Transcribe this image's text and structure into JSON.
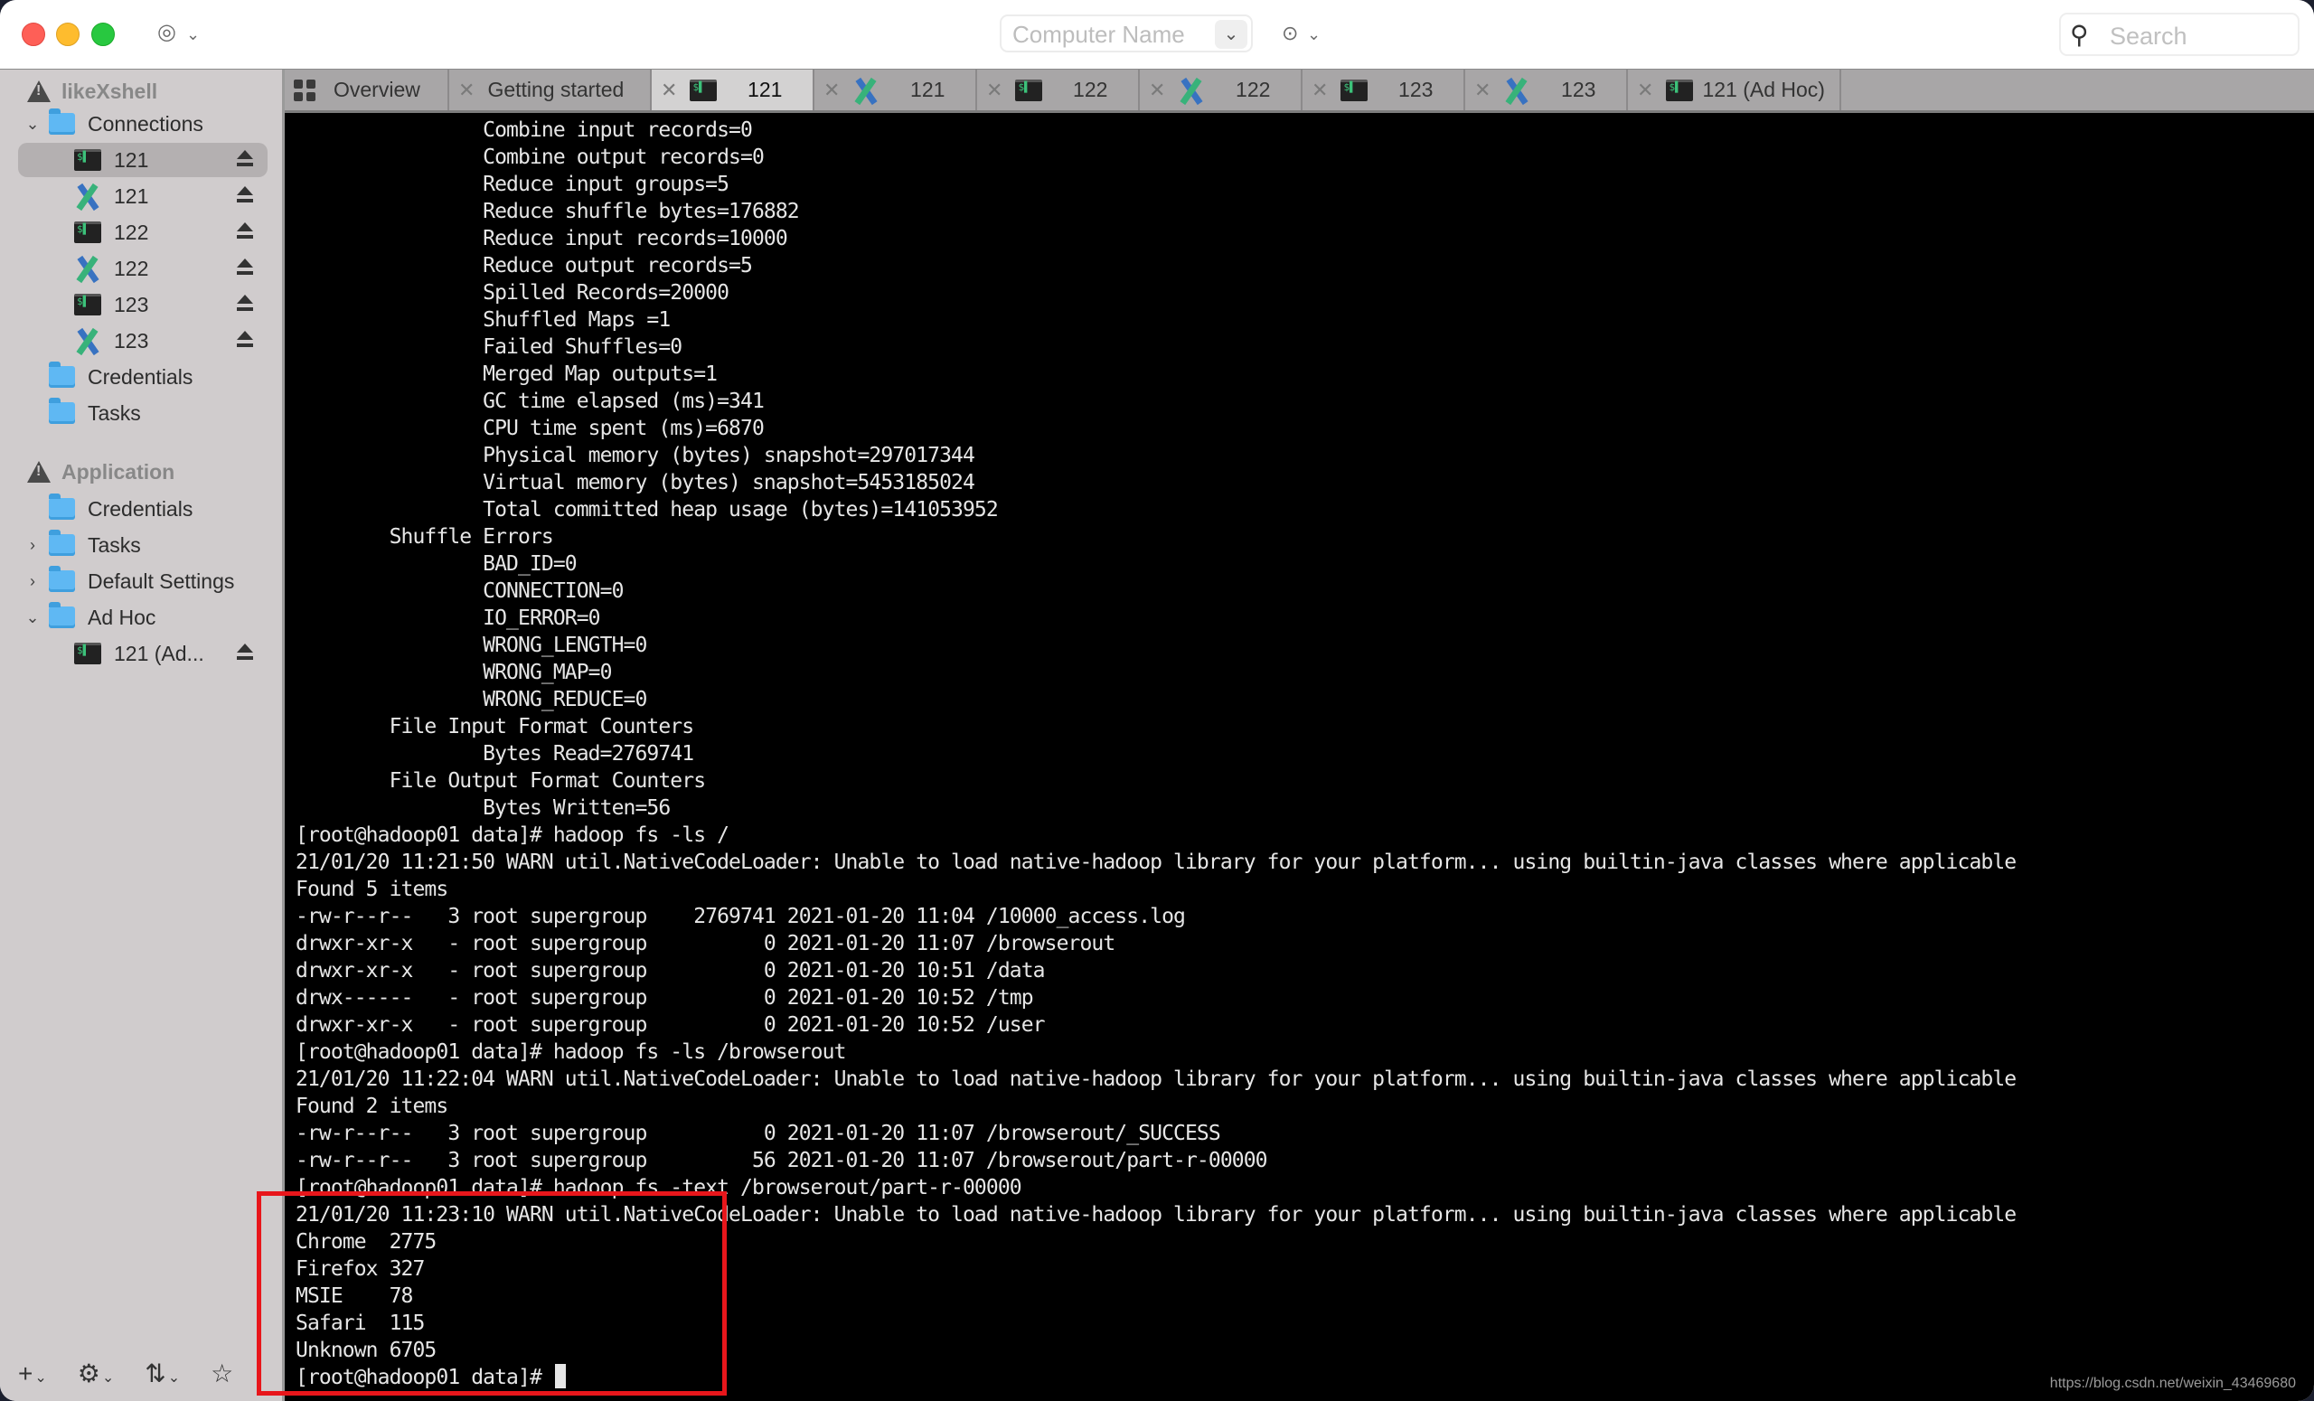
{
  "titlebar": {
    "computer_name_placeholder": "Computer Name",
    "search_placeholder": "Search"
  },
  "sidebar": {
    "app_section": "likeXshell",
    "connections_folder": "Connections",
    "connections": [
      {
        "type": "terminal",
        "label": "121",
        "selected": true
      },
      {
        "type": "sftp",
        "label": "121"
      },
      {
        "type": "terminal",
        "label": "122"
      },
      {
        "type": "sftp",
        "label": "122"
      },
      {
        "type": "terminal",
        "label": "123"
      },
      {
        "type": "sftp",
        "label": "123"
      }
    ],
    "credentials_label": "Credentials",
    "tasks_label": "Tasks",
    "application_section": "Application",
    "application_items": {
      "credentials": "Credentials",
      "tasks": "Tasks",
      "default_settings": "Default Settings",
      "ad_hoc": "Ad Hoc",
      "ad_hoc_child": "121 (Ad..."
    }
  },
  "tabs": [
    {
      "label": "Overview",
      "icon": "grid"
    },
    {
      "label": "Getting started",
      "icon": "none"
    },
    {
      "label": "121",
      "icon": "terminal",
      "active": true
    },
    {
      "label": "121",
      "icon": "sftp"
    },
    {
      "label": "122",
      "icon": "terminal"
    },
    {
      "label": "122",
      "icon": "sftp"
    },
    {
      "label": "123",
      "icon": "terminal"
    },
    {
      "label": "123",
      "icon": "sftp"
    },
    {
      "label": "121 (Ad Hoc)",
      "icon": "terminal"
    }
  ],
  "terminal": {
    "lines": [
      "                Combine input records=0",
      "                Combine output records=0",
      "                Reduce input groups=5",
      "                Reduce shuffle bytes=176882",
      "                Reduce input records=10000",
      "                Reduce output records=5",
      "                Spilled Records=20000",
      "                Shuffled Maps =1",
      "                Failed Shuffles=0",
      "                Merged Map outputs=1",
      "                GC time elapsed (ms)=341",
      "                CPU time spent (ms)=6870",
      "                Physical memory (bytes) snapshot=297017344",
      "                Virtual memory (bytes) snapshot=5453185024",
      "                Total committed heap usage (bytes)=141053952",
      "        Shuffle Errors",
      "                BAD_ID=0",
      "                CONNECTION=0",
      "                IO_ERROR=0",
      "                WRONG_LENGTH=0",
      "                WRONG_MAP=0",
      "                WRONG_REDUCE=0",
      "        File Input Format Counters",
      "                Bytes Read=2769741",
      "        File Output Format Counters",
      "                Bytes Written=56",
      "[root@hadoop01 data]# hadoop fs -ls /",
      "21/01/20 11:21:50 WARN util.NativeCodeLoader: Unable to load native-hadoop library for your platform... using builtin-java classes where applicable",
      "Found 5 items",
      "-rw-r--r--   3 root supergroup    2769741 2021-01-20 11:04 /10000_access.log",
      "drwxr-xr-x   - root supergroup          0 2021-01-20 11:07 /browserout",
      "drwxr-xr-x   - root supergroup          0 2021-01-20 10:51 /data",
      "drwx------   - root supergroup          0 2021-01-20 10:52 /tmp",
      "drwxr-xr-x   - root supergroup          0 2021-01-20 10:52 /user",
      "[root@hadoop01 data]# hadoop fs -ls /browserout",
      "21/01/20 11:22:04 WARN util.NativeCodeLoader: Unable to load native-hadoop library for your platform... using builtin-java classes where applicable",
      "Found 2 items",
      "-rw-r--r--   3 root supergroup          0 2021-01-20 11:07 /browserout/_SUCCESS",
      "-rw-r--r--   3 root supergroup         56 2021-01-20 11:07 /browserout/part-r-00000",
      "[root@hadoop01 data]# hadoop fs -text /browserout/part-r-00000",
      "21/01/20 11:23:10 WARN util.NativeCodeLoader: Unable to load native-hadoop library for your platform... using builtin-java classes where applicable",
      "Chrome  2775",
      "Firefox 327",
      "MSIE    78",
      "Safari  115",
      "Unknown 6705"
    ],
    "prompt": "[root@hadoop01 data]# "
  },
  "highlight_color": "#e8161b",
  "watermark": "https://blog.csdn.net/weixin_43469680"
}
